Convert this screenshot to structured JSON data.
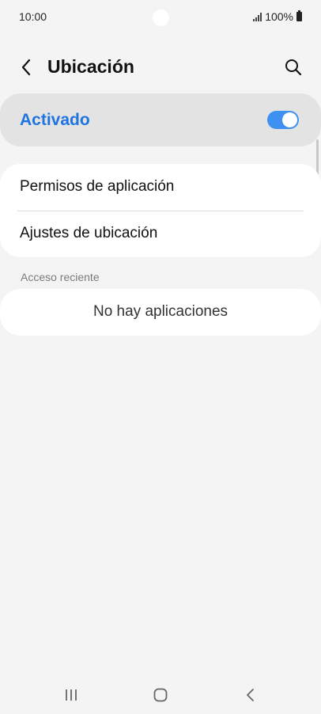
{
  "status_bar": {
    "time": "10:00",
    "battery": "100%",
    "icons": [
      "signal-icon",
      "battery-icon"
    ]
  },
  "header": {
    "title": "Ubicación",
    "back_icon": "chevron-left-icon",
    "search_icon": "search-icon"
  },
  "master_switch": {
    "label": "Activado",
    "state": true,
    "accent_color": "#1f74e0",
    "toggle_color": "#3e91f1"
  },
  "settings": {
    "items": [
      {
        "label": "Permisos de aplicación"
      },
      {
        "label": "Ajustes de ubicación"
      }
    ]
  },
  "recent": {
    "header": "Acceso reciente",
    "empty_text": "No hay aplicaciones"
  },
  "nav_bar": {
    "icons": [
      "recent-apps-icon",
      "home-icon",
      "back-icon"
    ]
  }
}
